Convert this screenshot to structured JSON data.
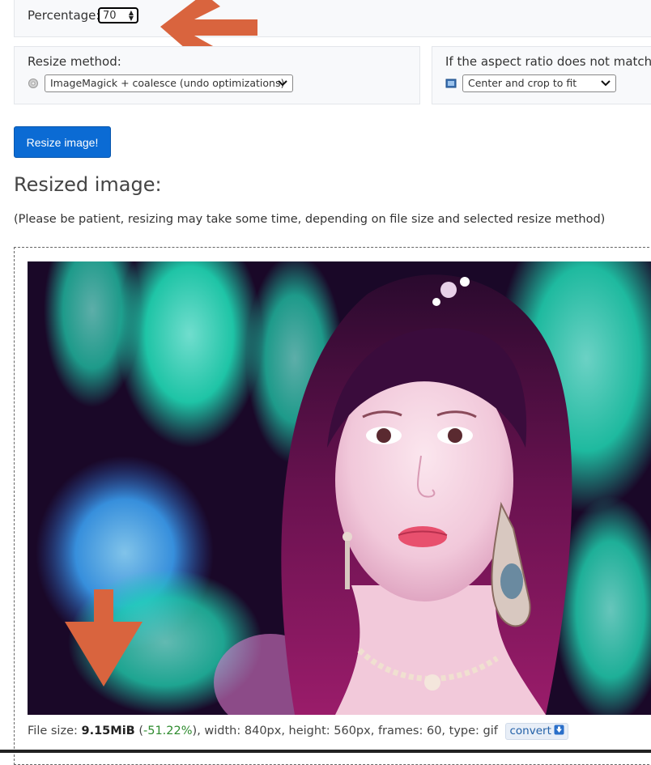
{
  "percentage": {
    "label": "Percentage:",
    "value": "70"
  },
  "resize_method": {
    "label": "Resize method:",
    "selected": "ImageMagick + coalesce (undo optimizations)",
    "icon": "gear-icon"
  },
  "aspect_ratio": {
    "label": "If the aspect ratio does not match:",
    "selected": "Center and crop to fit",
    "icon": "crop-image-icon"
  },
  "resize_button": {
    "label": "Resize image!"
  },
  "result": {
    "heading": "Resized image:",
    "note": "(Please be patient, resizing may take some time, depending on file size and selected resize method)"
  },
  "file_info": {
    "prefix": "File size: ",
    "size": "9.15MiB",
    "change": "-51.22%",
    "details": "), width: 840px, height: 560px, frames: 60, type: gif",
    "convert_label": "convert"
  },
  "colors": {
    "accent_button": "#0b6bd4",
    "annotation_arrow": "#d9643e",
    "size_change": "#2e8b2e"
  }
}
